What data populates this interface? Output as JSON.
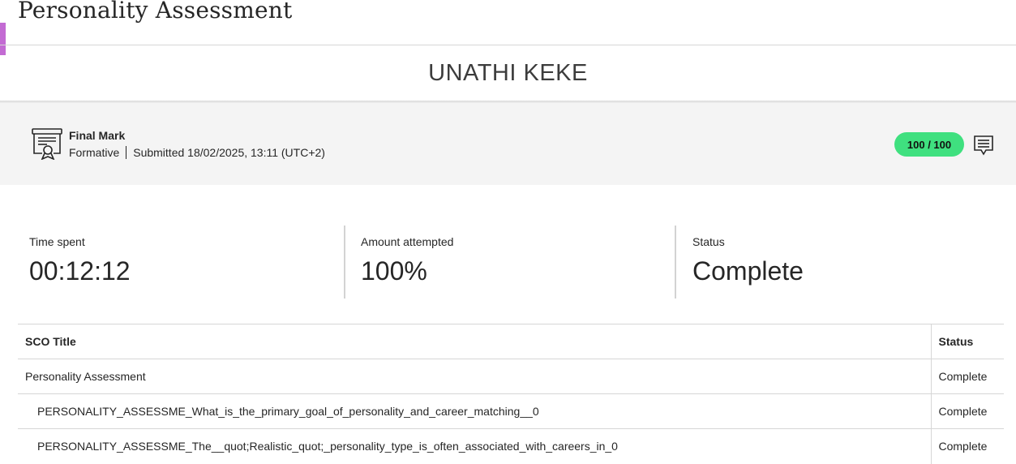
{
  "header": {
    "title": "Personality Assessment",
    "accent_color": "#c36bd3"
  },
  "student": {
    "name": "UNATHI KEKE"
  },
  "grade": {
    "icon": "certificate-icon",
    "label": "Final Mark",
    "type": "Formative",
    "submitted": "Submitted 18/02/2025, 13:11 (UTC+2)",
    "score": "100 / 100",
    "score_color": "#3fe07f",
    "feedback_icon": "feedback-comment-icon"
  },
  "stats": [
    {
      "label": "Time spent",
      "value": "00:12:12"
    },
    {
      "label": "Amount attempted",
      "value": "100%"
    },
    {
      "label": "Status",
      "value": "Complete"
    }
  ],
  "sco_table": {
    "headers": {
      "title": "SCO Title",
      "status": "Status"
    },
    "rows": [
      {
        "title": "Personality Assessment",
        "status": "Complete"
      },
      {
        "title": "PERSONALITY_ASSESSME_What_is_the_primary_goal_of_personality_and_career_matching__0",
        "status": "Complete"
      },
      {
        "title": "PERSONALITY_ASSESSME_The__quot;Realistic_quot;_personality_type_is_often_associated_with_careers_in_0",
        "status": "Complete"
      }
    ]
  }
}
